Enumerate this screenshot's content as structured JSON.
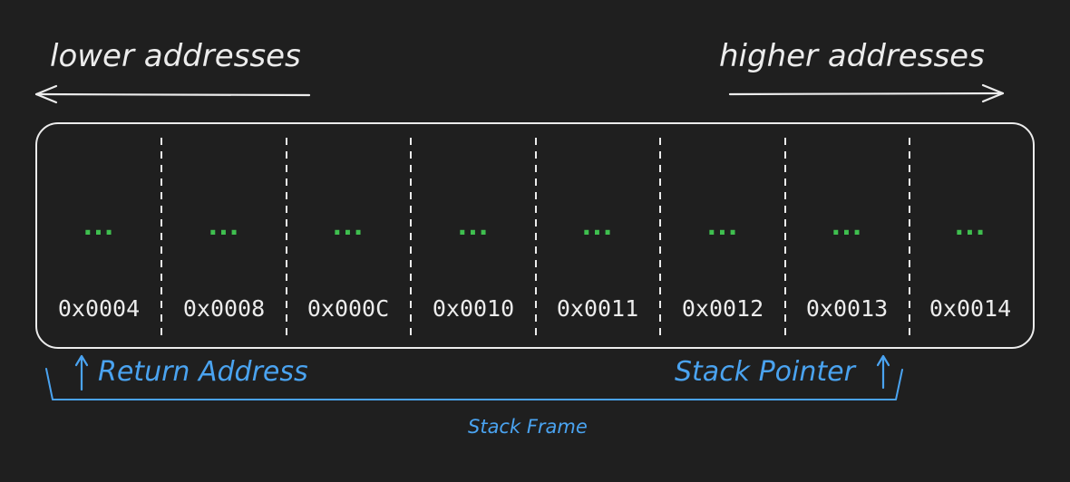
{
  "labels": {
    "lower": "lower addresses",
    "higher": "higher addresses",
    "return_address": "Return Address",
    "stack_pointer": "Stack Pointer",
    "stack_frame": "Stack Frame"
  },
  "cells": [
    {
      "value": "...",
      "address": "0x0004"
    },
    {
      "value": "...",
      "address": "0x0008"
    },
    {
      "value": "...",
      "address": "0x000C"
    },
    {
      "value": "...",
      "address": "0x0010"
    },
    {
      "value": "...",
      "address": "0x0011"
    },
    {
      "value": "...",
      "address": "0x0012"
    },
    {
      "value": "...",
      "address": "0x0013"
    },
    {
      "value": "...",
      "address": "0x0014"
    }
  ],
  "colors": {
    "background": "#1f1f1f",
    "stroke": "#ececec",
    "value": "#3fbf4f",
    "annotation": "#4aa3f0"
  }
}
